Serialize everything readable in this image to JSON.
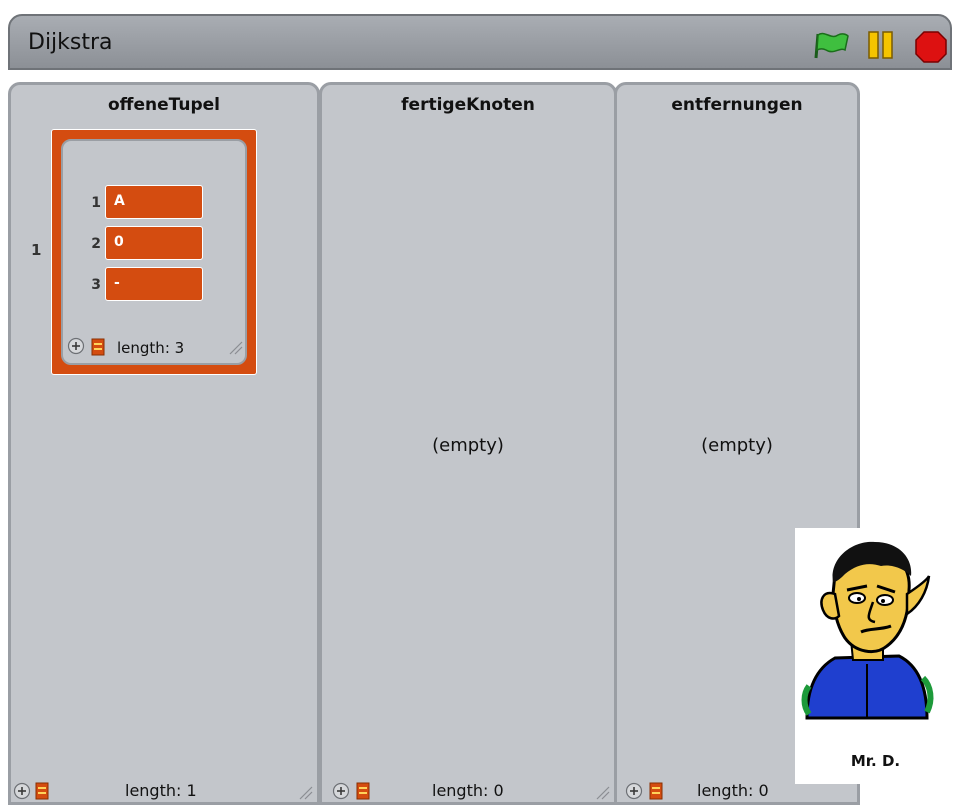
{
  "header": {
    "title": "Dijkstra",
    "controls": {
      "green_flag": "green-flag-icon",
      "pause": "pause-icon",
      "stop": "stop-icon"
    }
  },
  "lists": [
    {
      "title": "offeneTupel",
      "items": [
        {
          "index": "1",
          "sublist": {
            "items": [
              {
                "index": "1",
                "value": "A"
              },
              {
                "index": "2",
                "value": "0"
              },
              {
                "index": "3",
                "value": "-"
              }
            ],
            "length_label": "length: 3"
          }
        }
      ],
      "length_label": "length: 1"
    },
    {
      "title": "fertigeKnoten",
      "empty_label": "(empty)",
      "length_label": "length: 0"
    },
    {
      "title": "entfernungen",
      "empty_label": "(empty)",
      "length_label": "length: 0"
    }
  ],
  "sprite": {
    "name": "Mr. D."
  },
  "colors": {
    "list_item": "#d44c10",
    "panel": "#c3c6cb",
    "titlebar": "#9a9ea4"
  }
}
